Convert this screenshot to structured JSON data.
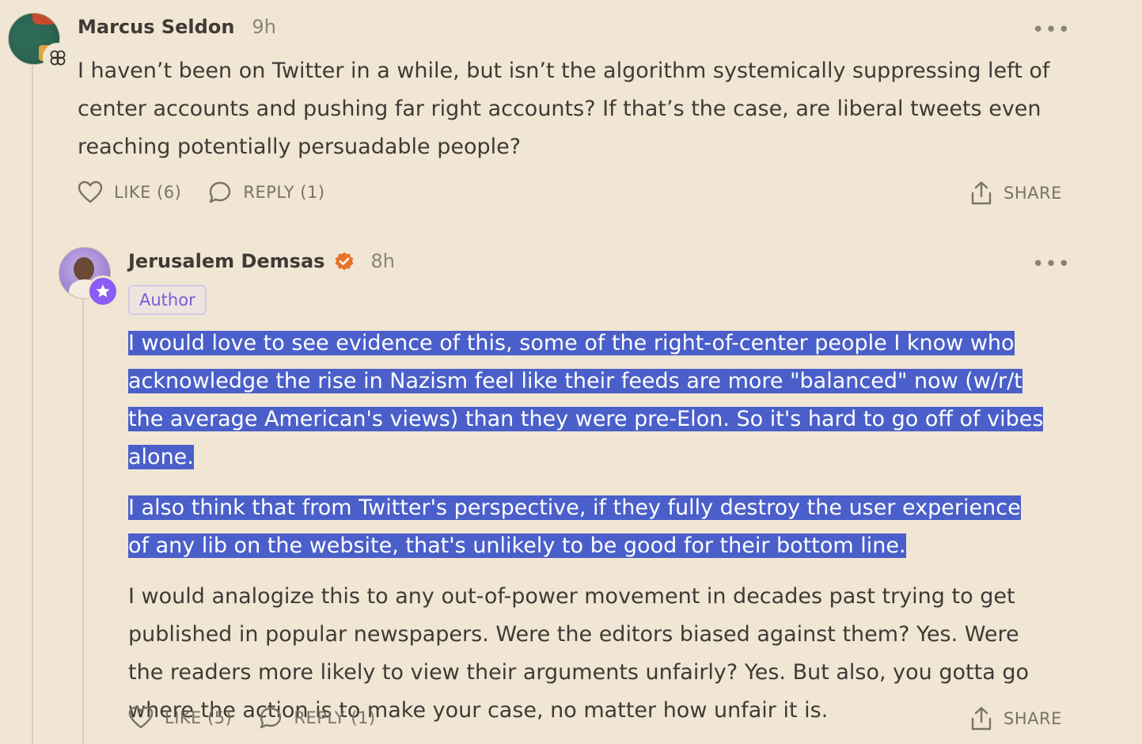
{
  "comments": [
    {
      "author": "Marcus Seldon",
      "time": "9h",
      "text": [
        "I haven’t been on Twitter in a while, but isn’t the algorithm systemically suppressing left of center accounts and pushing far right accounts? If that’s the case, are liberal tweets even reaching potentially persuadable people?"
      ],
      "like_label": "LIKE (6)",
      "reply_label": "REPLY (1)",
      "share_label": "SHARE",
      "more_label": "•••"
    },
    {
      "author": "Jerusalem Demsas",
      "time": "8h",
      "author_tag": "Author",
      "verified": true,
      "text": [
        "I would love to see evidence of this, some of the right-of-center people I know who acknowledge the rise in Nazism feel like their feeds are more \"balanced\" now (w/r/t the average American's views) than they were pre-Elon. So it's hard to go off of vibes alone.",
        "I also think that from Twitter's perspective, if they fully destroy the user experience of any lib on the website, that's unlikely to be good for their bottom line.",
        "I would analogize this to any out-of-power movement in decades past trying to get published in popular newspapers. Were the editors biased against them? Yes. Were the readers more likely to view their arguments unfairly? Yes. But also, you gotta go where the action is to make your case, no matter how unfair it is."
      ],
      "like_label": "LIKE (5)",
      "reply_label": "REPLY (1)",
      "share_label": "SHARE",
      "more_label": "•••"
    }
  ],
  "colors": {
    "background": "#f1e6d4",
    "highlight": "#4a5fc9",
    "verified": "#e8742a",
    "author_tag": "#7a5ad6",
    "star_badge": "#8b5cf6"
  },
  "icons": [
    "heart-icon",
    "speech-bubble-icon",
    "share-upload-icon",
    "more-dots-icon",
    "verified-check-icon",
    "star-badge-icon",
    "substack-logo-badge"
  ]
}
